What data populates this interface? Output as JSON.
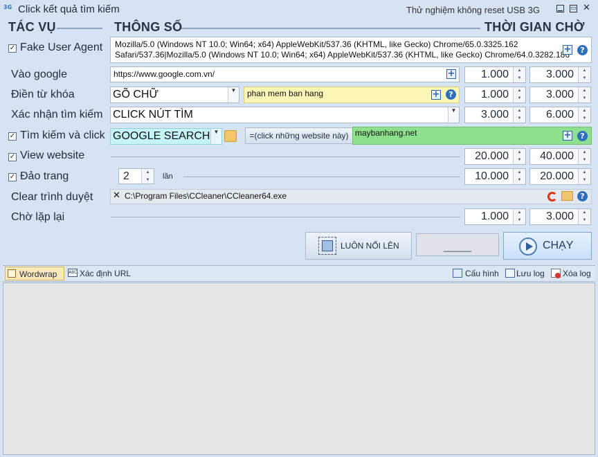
{
  "window": {
    "icon_text": "3G",
    "title": "Click kết quả tìm kiếm",
    "subtitle": "Thử nghiệm không reset USB 3G"
  },
  "sections": {
    "task": "TÁC VỤ",
    "params": "THÔNG SỐ",
    "wait": "THỜI GIAN CHỜ"
  },
  "rows": {
    "fake_ua": {
      "label": "Fake User Agent",
      "checked": true,
      "line1": "Mozilla/5.0 (Windows NT 10.0; Win64; x64) AppleWebKit/537.36 (KHTML, like Gecko) Chrome/65.0.3325.162",
      "line2": "Safari/537.36|Mozilla/5.0 (Windows NT 10.0; Win64; x64) AppleWebKit/537.36 (KHTML, like Gecko) Chrome/64.0.3282.186"
    },
    "goto_google": {
      "label": "Vào google",
      "url": "https://www.google.com.vn/",
      "min": "1.000",
      "max": "3.000"
    },
    "keyword": {
      "label": "Điền từ khóa",
      "mode": "GÕ CHỮ",
      "value": "phan mem ban hang",
      "min": "1.000",
      "max": "3.000"
    },
    "confirm": {
      "label": "Xác nhận tìm kiếm",
      "mode": "CLICK NÚT TÌM",
      "min": "3.000",
      "max": "6.000"
    },
    "search_click": {
      "label": "Tìm kiếm và click",
      "checked": true,
      "mode": "GOOGLE SEARCH",
      "hint": "=(click những website này)",
      "sites": "maybanhang.net"
    },
    "view": {
      "label": "View website",
      "checked": true,
      "min": "20.000",
      "max": "40.000"
    },
    "flip": {
      "label": "Đảo trang",
      "checked": true,
      "count": "2",
      "unit": "lần",
      "min": "10.000",
      "max": "20.000"
    },
    "clear": {
      "label": "Clear trình duyệt",
      "path": "C:\\Program Files\\CCleaner\\CCleaner64.exe"
    },
    "repeat": {
      "label": "Chờ lặp lại",
      "min": "1.000",
      "max": "3.000"
    }
  },
  "buttons": {
    "always_on_top": "LUÔN NỔI LÊN",
    "blank": "______",
    "run": "CHẠY"
  },
  "toolbar": {
    "wordwrap": "Wordwrap",
    "url_detect": "Xác định URL",
    "config": "Cấu hình",
    "save_log": "Lưu log",
    "clear_log": "Xóa log"
  },
  "colors": {
    "window_bg": "#d6e3f3",
    "keyword_bg": "#fcf7b6",
    "search_mode_bg": "#c4f3f8",
    "sites_bg": "#8de08d",
    "run_bg": "#d7eafc"
  }
}
